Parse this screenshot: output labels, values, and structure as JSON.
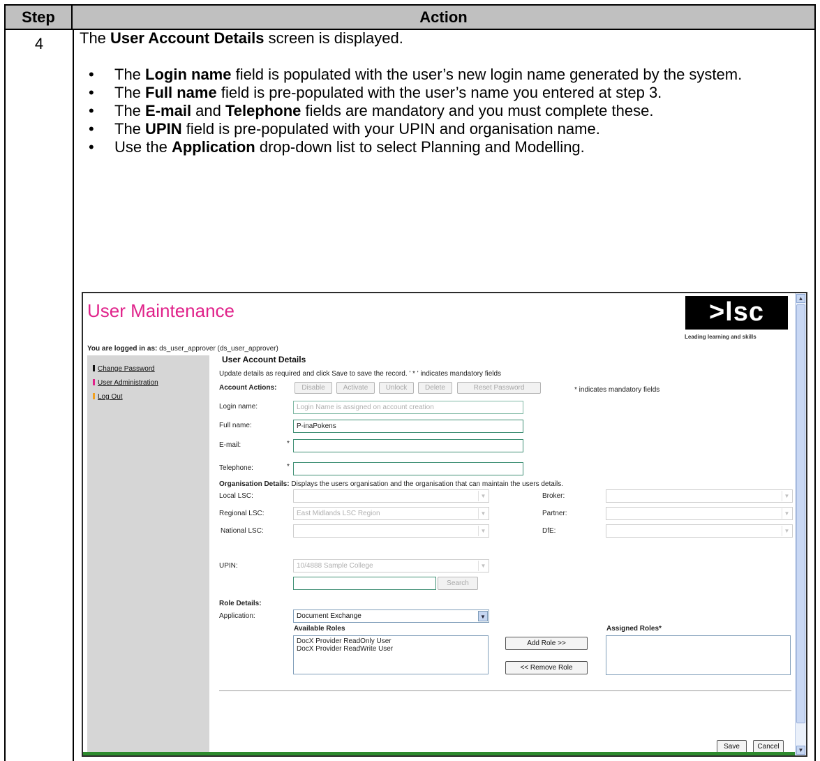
{
  "table": {
    "header_step": "Step",
    "header_action": "Action",
    "step_number": "4"
  },
  "intro": {
    "pre": "The ",
    "bold": "User Account Details",
    "post": " screen is displayed."
  },
  "bullets": [
    {
      "pre": "The ",
      "bold": "Login name",
      "mid": "",
      "bold2": "",
      "post": " field is populated with the user’s new login name generated by the system."
    },
    {
      "pre": "The ",
      "bold": "Full name",
      "mid": "",
      "bold2": "",
      "post": " field is pre-populated with the user’s name you entered at step 3."
    },
    {
      "pre": "The ",
      "bold": "E-mail",
      "mid": " and ",
      "bold2": "Telephone",
      "post": " fields are mandatory and you must complete these."
    },
    {
      "pre": "The ",
      "bold": "UPIN",
      "mid": "",
      "bold2": "",
      "post": " field is pre-populated with your UPIN and organisation name."
    },
    {
      "pre": "Use the ",
      "bold": "Application",
      "mid": "",
      "bold2": "",
      "post": " drop-down list to select Planning and Modelling."
    }
  ],
  "screenshot": {
    "title": "User Maintenance",
    "logo": ">lsc",
    "tagline": "Leading learning and skills",
    "logged_label": "You are logged in as:",
    "logged_user": " ds_user_approver (ds_user_approver)",
    "sidebar": [
      {
        "label": "Change Password",
        "color": "#111111"
      },
      {
        "label": "User Administration",
        "color": "#e0228a"
      },
      {
        "label": "Log Out",
        "color": "#f0a020"
      }
    ],
    "section_title": "User Account Details",
    "update_text": "Update details as required and click Save to save the record.   ' * ' indicates mandatory fields",
    "account_actions_label": "Account Actions:",
    "actions": [
      "Disable",
      "Activate",
      "Unlock",
      "Delete",
      "Reset Password"
    ],
    "mandatory_note": "* indicates mandatory fields",
    "fields": {
      "login_label": "Login name:",
      "login_value": "Login Name is assigned on account creation",
      "fullname_label": "Full name:",
      "fullname_value": "P-inaPokens",
      "email_label": "E-mail:",
      "telephone_label": "Telephone:",
      "asterisk": "*"
    },
    "org": {
      "heading_bold": "Organisation Details:",
      "heading_text": " Displays the users organisation and the organisation that can maintain the users details.",
      "local_label": "Local LSC:",
      "regional_label": "Regional LSC:",
      "regional_value": "East Midlands LSC Region",
      "national_label": "National LSC:",
      "broker_label": "Broker:",
      "partner_label": "Partner:",
      "dfe_label": "DfE:",
      "upin_label": "UPIN:",
      "upin_value": "10/4888  Sample College",
      "search_button": "Search"
    },
    "roles": {
      "heading": "Role Details:",
      "application_label": "Application:",
      "application_value": "Document Exchange",
      "available_label": "Available Roles",
      "available_items": [
        "DocX Provider ReadOnly User",
        "DocX Provider ReadWrite User"
      ],
      "assigned_label": "Assigned Roles*",
      "add_button": "Add Role >>",
      "remove_button": "<< Remove Role"
    },
    "footer": {
      "save": "Save",
      "cancel": "Cancel"
    },
    "colors": {
      "title": "#e0228a",
      "status_bar": "#2e8b2e"
    }
  }
}
